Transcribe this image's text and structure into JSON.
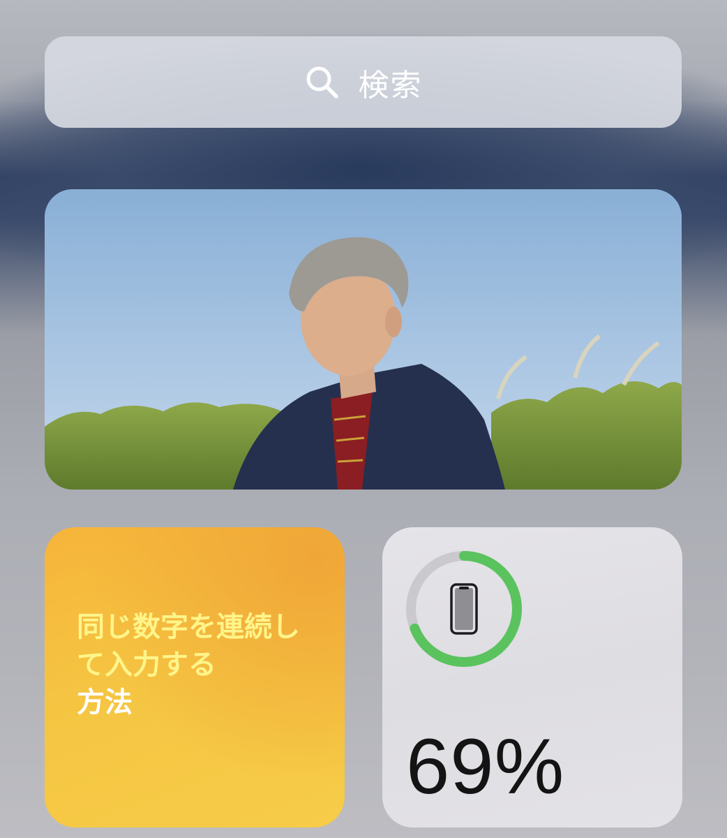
{
  "search": {
    "label": "検索",
    "icon": "search-icon"
  },
  "photo_widget": {
    "icon": "photo"
  },
  "notes_widget": {
    "title": "同じ数字を連続して入力する",
    "subtitle": "方法",
    "title_color": "#fff58a",
    "background": "#f5c542"
  },
  "battery_widget": {
    "device_icon": "iphone-icon",
    "level": 0.69,
    "percent_text": "69%",
    "ring_color": "#5ac35e",
    "track_color": "#c9c9ce"
  }
}
